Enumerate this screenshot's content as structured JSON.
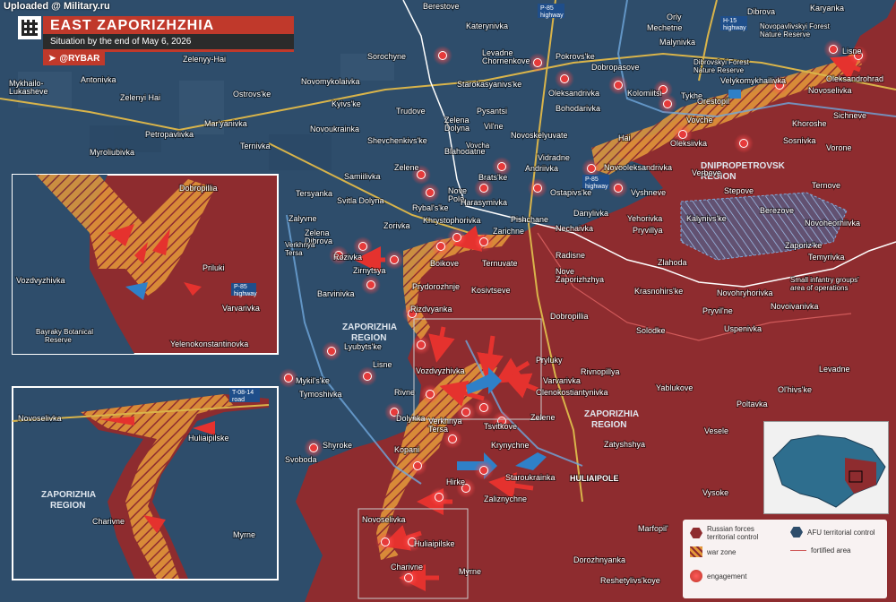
{
  "watermark": "Uploaded @ Military.ru",
  "header": {
    "title": "EAST ZAPORIZHZHIA DIRECTION",
    "subtitle": "Situation by the end of May 6, 2026",
    "brand": "@RYBAR"
  },
  "colors": {
    "russian": "#8e2c2f",
    "afu": "#2e4d6b",
    "warzone": "#e59a3a",
    "engagement": "#e63a3a",
    "arrow_red": "#e5322e",
    "arrow_blue": "#2f80c8",
    "road": "#d9b44a"
  },
  "regions": {
    "dnipro": "DNIPROPETROVSK\nREGION",
    "zap_center": "ZAPORIZHIA\nREGION",
    "zap_east": "ZAPORIZHIA\nREGION",
    "zap_inset": "ZAPORIZHIA\nREGION"
  },
  "highways": {
    "p85_top": "P-85\nhighway",
    "h15": "H-15\nhighway",
    "p85_mid": "P-85\nhighway",
    "p85_inset": "P-85\nhighway",
    "t0814": "T-08-14\nroad"
  },
  "map_labels": {
    "berestove": "Berestove",
    "katerynivka": "Katerynivka",
    "orly": "Orly",
    "dibrova": "Dibrova",
    "karyanka": "Karyanka",
    "mechetne": "Mechetne",
    "malynivka": "Malynivka",
    "novopavlivskyi": "Novopavlivskyi Forest\nNature Reserve",
    "lisne_ne": "Lisne",
    "zelenyi_hai": "Zelenyy-Hai",
    "sorochyne": "Sorochyne",
    "levadne_ch": "Levadne\nChornenkove",
    "pokrovske": "Pokrovs'ke",
    "dobropasove": "Dobropasove",
    "dibrovskyi": "Dibrovskyi Forest\nNature Reserve",
    "velykomykhailivka": "Velykomykhailivka",
    "novoselivka_ne": "Novoselivka",
    "oleksandrohrad": "Oleksandrohrad",
    "mykhailo": "Mykhailo-\nLukasheve",
    "antonivka": "Antonivka",
    "novomykolaivka": "Novomykolaivka",
    "starokasyanivske": "Starokasyanivs'ke",
    "oleksandrivka": "Oleksandrivka",
    "kolomiitsi": "Kolomiitsi",
    "tykhe": "Tykhe",
    "orestopil": "Orestopil",
    "zelenyi_hai2": "Zelenyi Hai",
    "ostrovske": "Ostrovs'ke",
    "kyivske": "Kyivs'ke",
    "trudove": "Trudove",
    "pysantsi": "Pysantsi",
    "bohodarivka": "Bohodarivka",
    "vovche": "Vovche",
    "khoroshe": "Khoroshe",
    "sichneve": "Sichneve",
    "maryanivka": "Mar'yanivka",
    "petropavlivka": "Petropavlivka",
    "novoukrainka": "Novoukrainka",
    "zelena_dolyna": "Zelena\nDolyna",
    "vilne": "Vil'ne",
    "novoskelyuvate": "Novoskelyuvate",
    "hai": "Hai",
    "oleksiivka": "Oleksiivka",
    "sosnivka": "Sosnivka",
    "vorone": "Vorone",
    "myroliubivka": "Myroliubivka",
    "ternivka_w": "Ternivka",
    "shevchenkivske": "Shevchenkivs'ke",
    "blahodatne": "Blahodatne",
    "vidradne": "Vidradne",
    "andriivka": "Andriivka",
    "novooleksandrivka": "Novooleksandrivka",
    "zelene": "Zelene",
    "samiilivka": "Samiilivka",
    "bratske": "Brats'ke",
    "ostapivske": "Ostapivs'ke",
    "vyshneve": "Vyshneve",
    "verbove": "Verbove",
    "stepove": "Stepove",
    "ternove": "Ternove",
    "tersyanka": "Tersyanka",
    "svitla_dolyna": "Svitla Dolyna",
    "nove_pole": "Nove\nPole",
    "harasymivka": "Harasymivka",
    "rybalske": "Rybal's'ke",
    "khrystoforivka": "Khrystophorivka",
    "danylivka": "Danylivka",
    "kalynivske": "Kalynivs'ke",
    "berezove": "Berezove",
    "novoheorhiivka": "Novoheorhiivka",
    "zalyvne": "Zalyvne",
    "pishchane": "Pishchane",
    "yehorivka": "Yehorivka",
    "zelena_dibrova": "Zelena\nDibrova",
    "zorivka": "Zorivka",
    "zarichne": "Zarichne",
    "nechaivka": "Nechaivka",
    "pryvillya": "Pryvillya",
    "zaporizke": "Zaporiz'ke",
    "rozivka": "Rozivka",
    "boikove": "Boikove",
    "ternuvate": "Ternuvate",
    "radisne": "Radisne",
    "temyrivka": "Temyrivka",
    "zlahoda": "Zlahoda",
    "zirnytsya": "Zirnytsya",
    "nove_zaporizhzhya": "Nove\nZaporizhzhya",
    "krasnohirske": "Krasnohirs'ke",
    "small_infantry": "Small infantry groups'\narea of operations",
    "prydorozhnje": "Prydorozhnje",
    "kosivtseve": "Kosivtseve",
    "barvinivka": "Barvinivka",
    "novohryhorivka": "Novohryhorivka",
    "rizdvyanka": "Rizdvyanka",
    "dobropillia": "Dobropillia",
    "pryvilne": "Pryvil'ne",
    "novoivanivka": "Novoivanivka",
    "uspenivka": "Uspenivka",
    "solodke": "Solodke",
    "lyubytske": "Lyubyts'ke",
    "lisne": "Lisne",
    "vozdvyzhivka": "Vozdvyzhivka",
    "pryluky": "Pryluky",
    "rivnopillya": "Rivnopillya",
    "levadne": "Levadne",
    "mykilske": "Mykil's'ke",
    "tymoshivka": "Tymoshivka",
    "varvarivka": "Varvarivka",
    "olenokostiantynivka": "Olenokostiantynivka",
    "yablukove": "Yablukove",
    "olhivske": "Ol'hivs'ke",
    "rivne": "Rivne",
    "dolynka": "Dolynka",
    "verkhnya_tersa": "Verkhnya\nTersa",
    "tsvitkove": "Tsvitkove",
    "zelene2": "Zelene",
    "poltavka": "Poltavka",
    "shyroke": "Shyroke",
    "kopani": "Kopani",
    "krynychne": "Krynychne",
    "zatyshshya": "Zatyshshya",
    "vesele": "Vesele",
    "svoboda": "Svoboda",
    "hirke": "Hirke",
    "starokrainka": "Staroukrainka",
    "huliaipole": "HULIAIPOLE",
    "vysoke": "Vysoke",
    "zaliznychne": "Zaliznychne",
    "novoselivka": "Novoselivka",
    "huliaipilske": "Huliaipilske",
    "marfopil": "Marfopil'",
    "charivne": "Charivne",
    "myrne": "Myrne",
    "dorozhnyanka": "Dorozhnyanka",
    "reshetylivske": "Reshetylivs'koye",
    "verkhnya_tersa_river": "Verkhnya\nTersa",
    "vovcha_river": "Vovcha"
  },
  "inset1": {
    "dobropillia": "Dobropillia",
    "vozdvyzhivka": "Vozdvyzhivka",
    "priluki": "Priluki",
    "varvarivka": "Varvarivka",
    "bayraky": "Bayraky Botanical\nReserve",
    "yelenokonst": "Yelenokonstantinovka"
  },
  "inset2": {
    "novoselivka": "Novoselivka",
    "huliaipilske": "Huliaipilske",
    "charivne": "Charivne",
    "myrne": "Myrne"
  },
  "legend": {
    "russian": "Russian forces\nterritorial control",
    "afu": "AFU territorial control",
    "warzone": "war zone",
    "fortified": "fortified area",
    "engagement": "engagement"
  }
}
